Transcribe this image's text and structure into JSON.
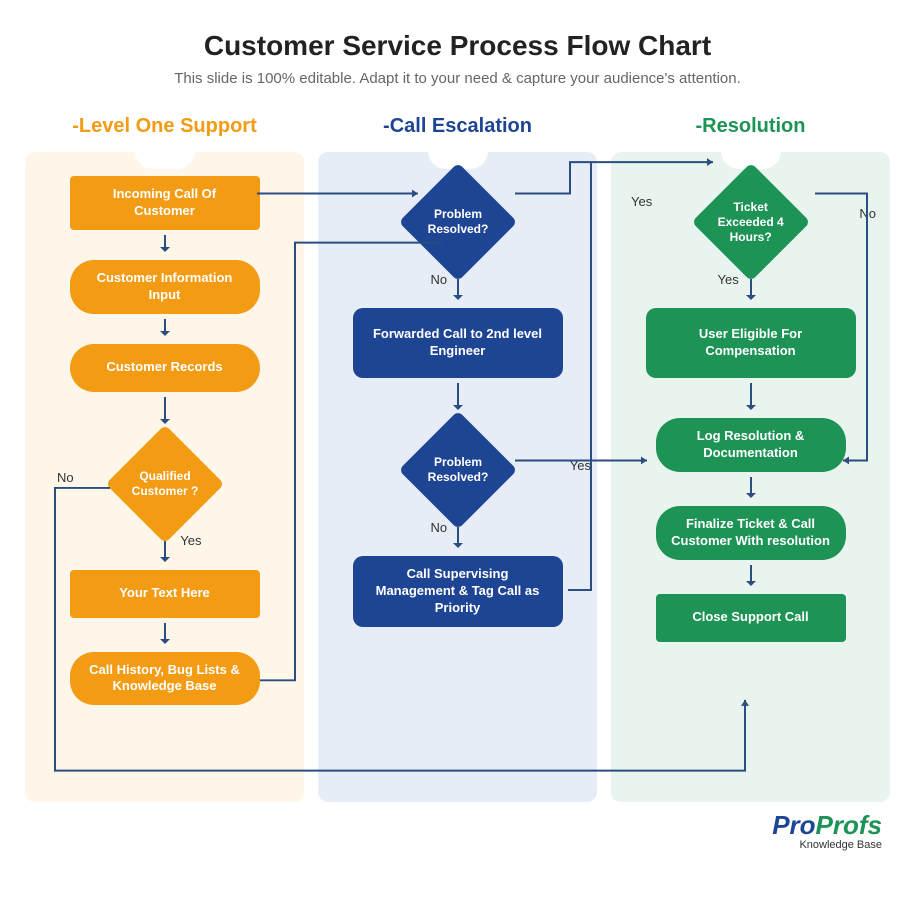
{
  "title": "Customer Service Process Flow Chart",
  "subtitle": "This slide is 100% editable. Adapt it to your need & capture your audience's attention.",
  "lanes": {
    "l1_header": "-Level One Support",
    "l2_header": "-Call Escalation",
    "l3_header": "-Resolution"
  },
  "l1": {
    "n1": "Incoming Call Of Customer",
    "n2": "Customer Information Input",
    "n3": "Customer Records",
    "d1": "Qualified Customer ?",
    "d1_no": "No",
    "d1_yes": "Yes",
    "n4": "Your Text Here",
    "n5": "Call History, Bug Lists & Knowledge Base"
  },
  "l2": {
    "d1": "Problem Resolved?",
    "d1_no": "No",
    "n1": "Forwarded Call to 2nd level Engineer",
    "d2": "Problem Resolved?",
    "d2_no": "No",
    "d2_yes": "Yes",
    "n2": "Call Supervising Management & Tag Call as Priority"
  },
  "l3": {
    "d1": "Ticket Exceeded 4 Hours?",
    "d1_yes_left": "Yes",
    "d1_yes_below": "Yes",
    "d1_no": "No",
    "n1": "User Eligible For Compensation",
    "n2": "Log Resolution & Documentation",
    "n3": "Finalize Ticket & Call Customer With resolution",
    "n4": "Close Support Call"
  },
  "brand": {
    "pro": "Pro",
    "profs": "Profs",
    "sub": "Knowledge Base"
  }
}
